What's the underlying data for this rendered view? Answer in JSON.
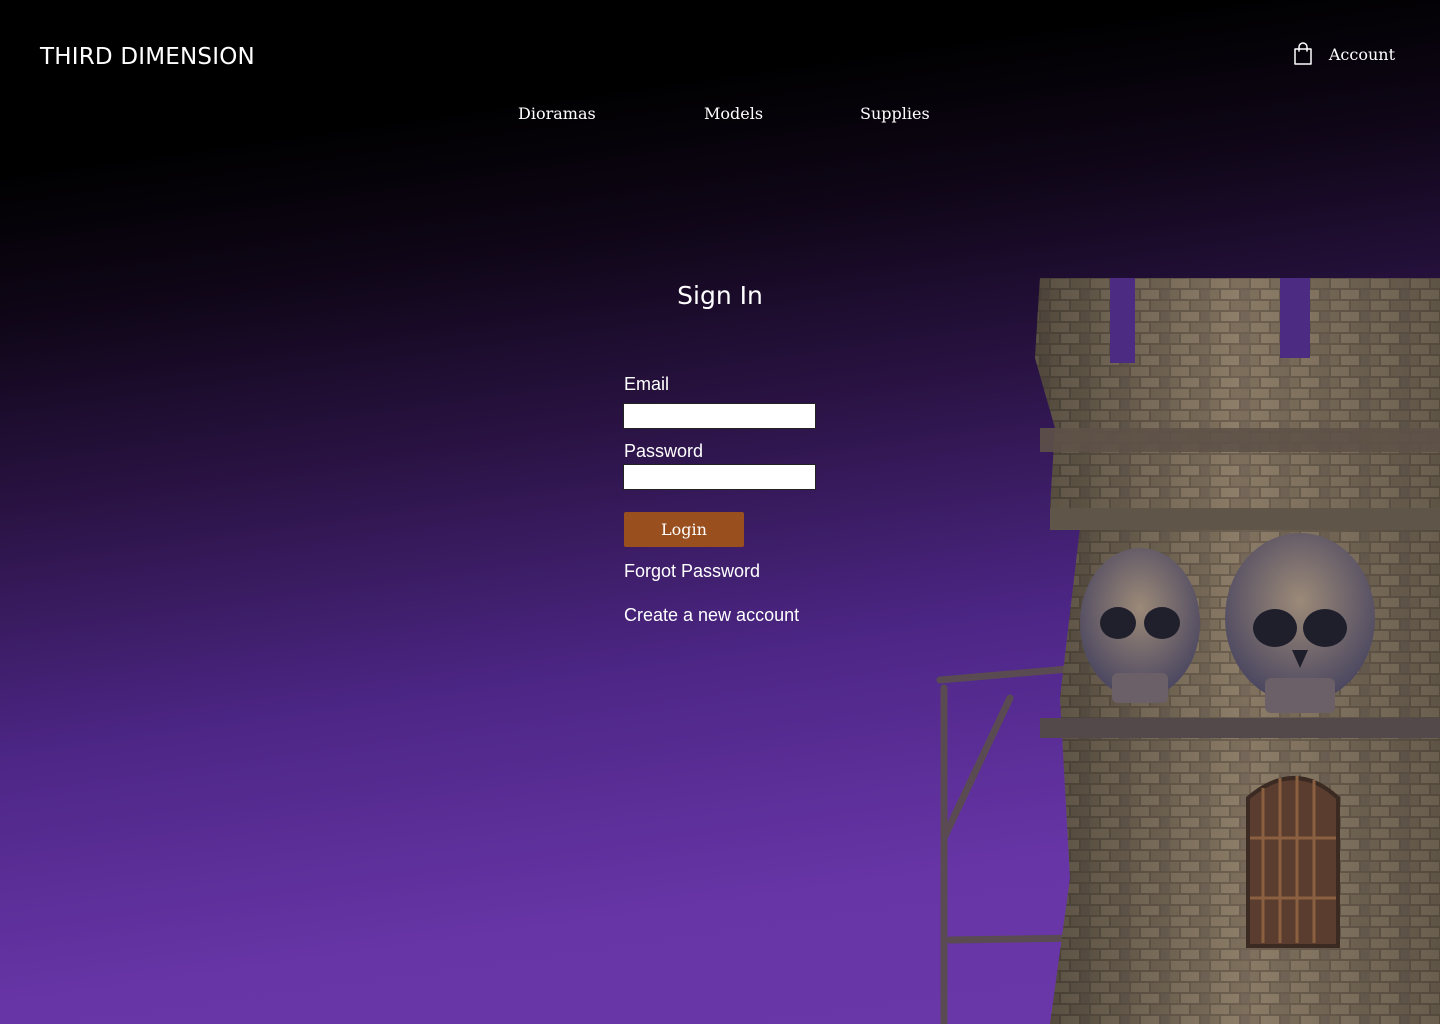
{
  "header": {
    "brand": "THIRD DIMENSION",
    "account_label": "Account",
    "account_icon": "shopping-bag-icon"
  },
  "nav": {
    "items": [
      {
        "label": "Dioramas"
      },
      {
        "label": "Models"
      },
      {
        "label": "Supplies"
      }
    ]
  },
  "signin": {
    "title": "Sign In",
    "email_label": "Email",
    "email_value": "",
    "password_label": "Password",
    "password_value": "",
    "login_button": "Login",
    "forgot_link": "Forgot Password",
    "create_link": "Create a new account"
  },
  "colors": {
    "background_top": "#000000",
    "background_bottom": "#6a38a8",
    "login_button": "#9a4f1f",
    "text": "#ffffff"
  }
}
